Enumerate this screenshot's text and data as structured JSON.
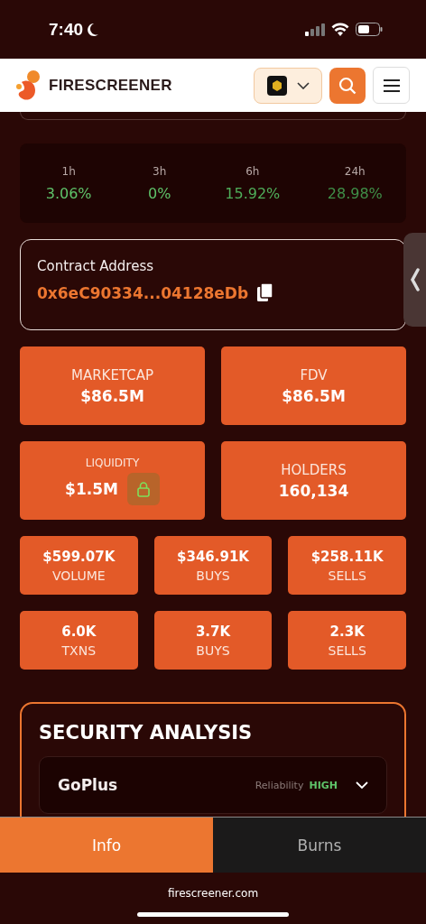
{
  "status_bar": {
    "time": "7:40"
  },
  "header": {
    "brand": "FIRESCREENER"
  },
  "price_changes": [
    {
      "period": "1h",
      "value": "3.06%",
      "color": "#5fc46a"
    },
    {
      "period": "3h",
      "value": "0%",
      "color": "#5fc46a"
    },
    {
      "period": "6h",
      "value": "15.92%",
      "color": "#4fae5a"
    },
    {
      "period": "24h",
      "value": "28.98%",
      "color": "#3f8f48"
    }
  ],
  "contract": {
    "label": "Contract Address",
    "address": "0x6eC90334...04128eDb"
  },
  "big_stats": [
    {
      "label": "MARKETCAP",
      "value": "$86.5M",
      "locked": false
    },
    {
      "label": "FDV",
      "value": "$86.5M",
      "locked": false
    },
    {
      "label": "LIQUIDITY",
      "value": "$1.5M",
      "locked": true
    },
    {
      "label": "HOLDERS",
      "value": "160,134",
      "locked": false
    }
  ],
  "small_stats": [
    {
      "value": "$599.07K",
      "label": "VOLUME"
    },
    {
      "value": "$346.91K",
      "label": "BUYS"
    },
    {
      "value": "$258.11K",
      "label": "SELLS"
    },
    {
      "value": "6.0K",
      "label": "TXNS"
    },
    {
      "value": "3.7K",
      "label": "BUYS"
    },
    {
      "value": "2.3K",
      "label": "SELLS"
    }
  ],
  "security": {
    "title": "SECURITY ANALYSIS",
    "providers": [
      {
        "name": "GoPlus",
        "reliability_label": "Reliability",
        "reliability": "HIGH",
        "expanded": false
      }
    ]
  },
  "tabs": [
    {
      "label": "Info",
      "selected": true
    },
    {
      "label": "Burns",
      "selected": false
    }
  ],
  "footer": {
    "url": "firescreener.com"
  }
}
